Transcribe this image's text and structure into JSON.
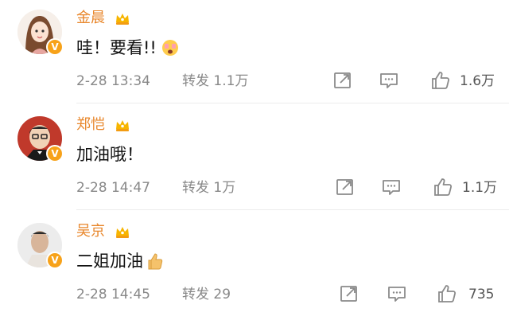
{
  "comments": [
    {
      "name": "金晨",
      "text": "哇！要看!!",
      "time": "2-28 13:34",
      "repost": "转发 1.1万",
      "likes": "1.6万"
    },
    {
      "name": "郑恺",
      "text": "加油哦！",
      "time": "2-28 14:47",
      "repost": "转发 1万",
      "likes": "1.1万"
    },
    {
      "name": "吴京",
      "text": "二姐加油",
      "time": "2-28 14:45",
      "repost": "转发 29",
      "likes": "735"
    }
  ],
  "badge_label": "V",
  "colors": {
    "name": "#e8862a",
    "verified_badge": "#f7a21a",
    "meta": "#888888",
    "icon": "#8a8a8a"
  }
}
